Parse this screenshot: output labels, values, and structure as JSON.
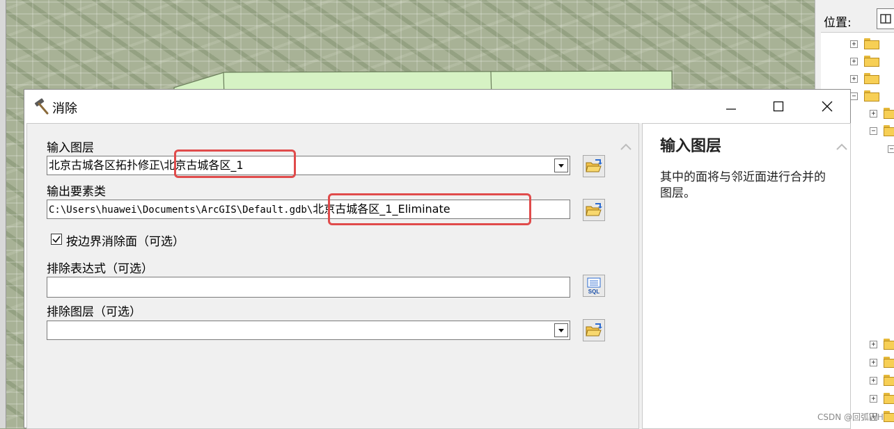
{
  "dialog": {
    "title": "消除",
    "fields": {
      "input_layer": {
        "label": "输入图层",
        "value_prefix": "北京古城各区拓扑修正\\",
        "value_highlight": "北京古城各区_1"
      },
      "output_feature_class": {
        "label": "输出要素类",
        "value_prefix": "C:\\Users\\huawei\\Documents\\ArcGIS\\Default.gdb\\",
        "value_highlight": "北京古城各区_1_Eliminate"
      },
      "eliminate_by_border": {
        "label": "按边界消除面（可选）",
        "checked": true
      },
      "exclusion_expression": {
        "label": "排除表达式（可选）",
        "value": "",
        "sql_label": "SQL"
      },
      "exclusion_layer": {
        "label": "排除图层（可选）",
        "value": ""
      }
    },
    "help": {
      "title": "输入图层",
      "body": "其中的面将与邻近面进行合并的图层。"
    }
  },
  "catalog": {
    "location_label": "位置:"
  },
  "watermark": "CSDN @回弧WH",
  "colors": {
    "highlight_border": "#e04b4b",
    "polygon_fill": "#d6f2c4",
    "folder": "#f7cf55"
  }
}
